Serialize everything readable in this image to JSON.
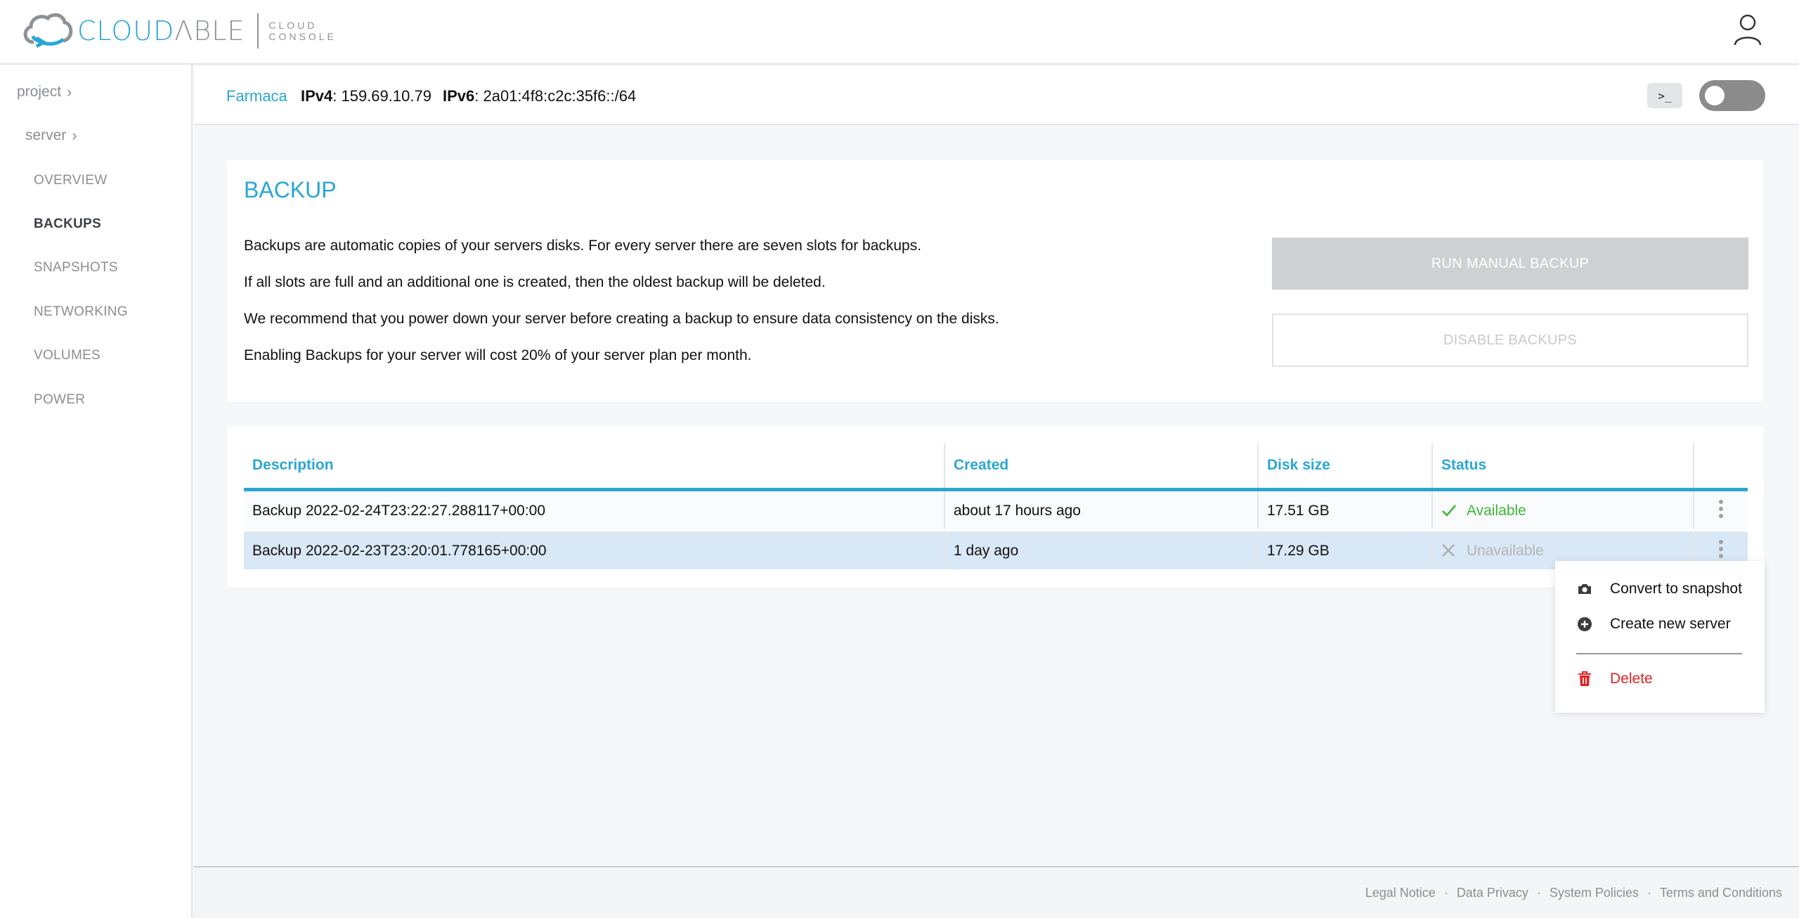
{
  "header": {
    "logo_main_a": "CLOUD",
    "logo_main_b": "ΛBLE",
    "logo_sub_1": "CLOUD",
    "logo_sub_2": "CONSOLE"
  },
  "sidebar": {
    "crumb_project": "project",
    "crumb_server": "server",
    "items": [
      {
        "label": "OVERVIEW"
      },
      {
        "label": "BACKUPS"
      },
      {
        "label": "SNAPSHOTS"
      },
      {
        "label": "NETWORKING"
      },
      {
        "label": "VOLUMES"
      },
      {
        "label": "POWER"
      }
    ]
  },
  "server": {
    "name": "Farmaca",
    "ipv4_label": "IPv4",
    "ipv4_value": ": 159.69.10.79",
    "ipv6_label": "IPv6",
    "ipv6_value": ": 2a01:4f8:c2c:35f6::/64",
    "terminal_label": ">_"
  },
  "backup": {
    "title": "BACKUP",
    "lines": [
      "Backups are automatic copies of your servers disks. For every server there are seven slots for backups.",
      "If all slots are full and an additional one is created, then the oldest backup will be deleted.",
      "We recommend that you power down your server before creating a backup to ensure data consistency on the disks.",
      "Enabling Backups for your server will cost 20% of your server plan per month."
    ],
    "run_button": "RUN MANUAL BACKUP",
    "disable_button": "DISABLE BACKUPS"
  },
  "table": {
    "headers": [
      "Description",
      "Created",
      "Disk size",
      "Status"
    ],
    "rows": [
      {
        "description": "Backup 2022-02-24T23:22:27.288117+00:00",
        "created": "about 17 hours ago",
        "size": "17.51 GB",
        "status": "Available"
      },
      {
        "description": "Backup 2022-02-23T23:20:01.778165+00:00",
        "created": "1 day ago",
        "size": "17.29 GB",
        "status": "Unavailable"
      }
    ]
  },
  "menu": {
    "convert": "Convert to snapshot",
    "create": "Create new server",
    "delete": "Delete"
  },
  "footer": {
    "links": [
      "Legal Notice",
      "Data Privacy",
      "System Policies",
      "Terms and Conditions"
    ]
  },
  "colors": {
    "accent": "#2aa6d6",
    "available": "#3fb63a",
    "danger": "#e02424",
    "selected_row": "#d9e8f6"
  }
}
